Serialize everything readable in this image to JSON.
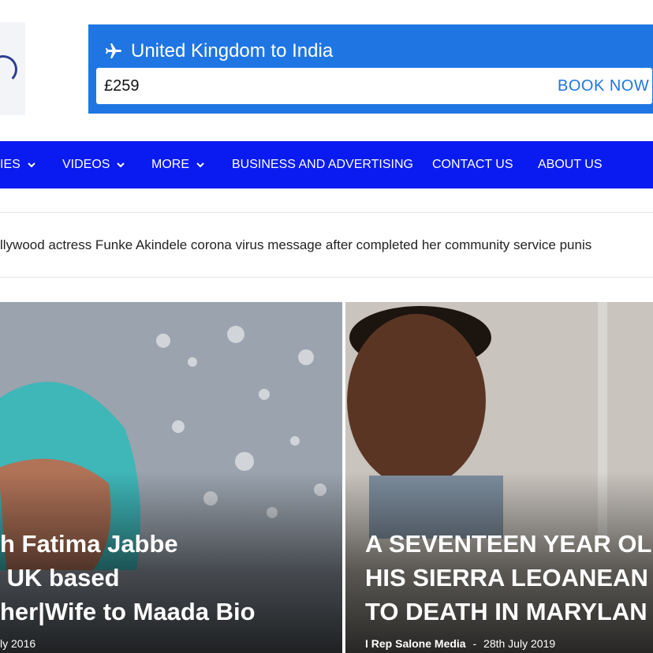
{
  "ad": {
    "route": "United Kingdom to India",
    "price": "£259",
    "cta": "BOOK NOW",
    "icon": "plane-icon",
    "color": "#1f76e3"
  },
  "nav": {
    "background": "#0a1bf2",
    "items": [
      {
        "label": "IES",
        "has_dropdown": true
      },
      {
        "label": "VIDEOS",
        "has_dropdown": true
      },
      {
        "label": "MORE",
        "has_dropdown": true
      },
      {
        "label": "BUSINESS AND ADVERTISING",
        "has_dropdown": false
      },
      {
        "label": "CONTACT US",
        "has_dropdown": false
      },
      {
        "label": "ABOUT US",
        "has_dropdown": false
      }
    ]
  },
  "ticker": {
    "text": "llywood actress Funke Akindele corona virus message after completed her community service punis"
  },
  "featured": [
    {
      "headline_lines": [
        "h Fatima Jabbe",
        " UK based",
        "her|Wife to Maada Bio"
      ],
      "date": "ly 2016"
    },
    {
      "headline_lines": [
        "A SEVENTEEN YEAR OLI",
        "HIS SIERRA LEOANEAN",
        "TO DEATH IN MARYLAN"
      ],
      "author": "I Rep Salone Media",
      "separator": "-",
      "date": "28th July 2019"
    }
  ]
}
